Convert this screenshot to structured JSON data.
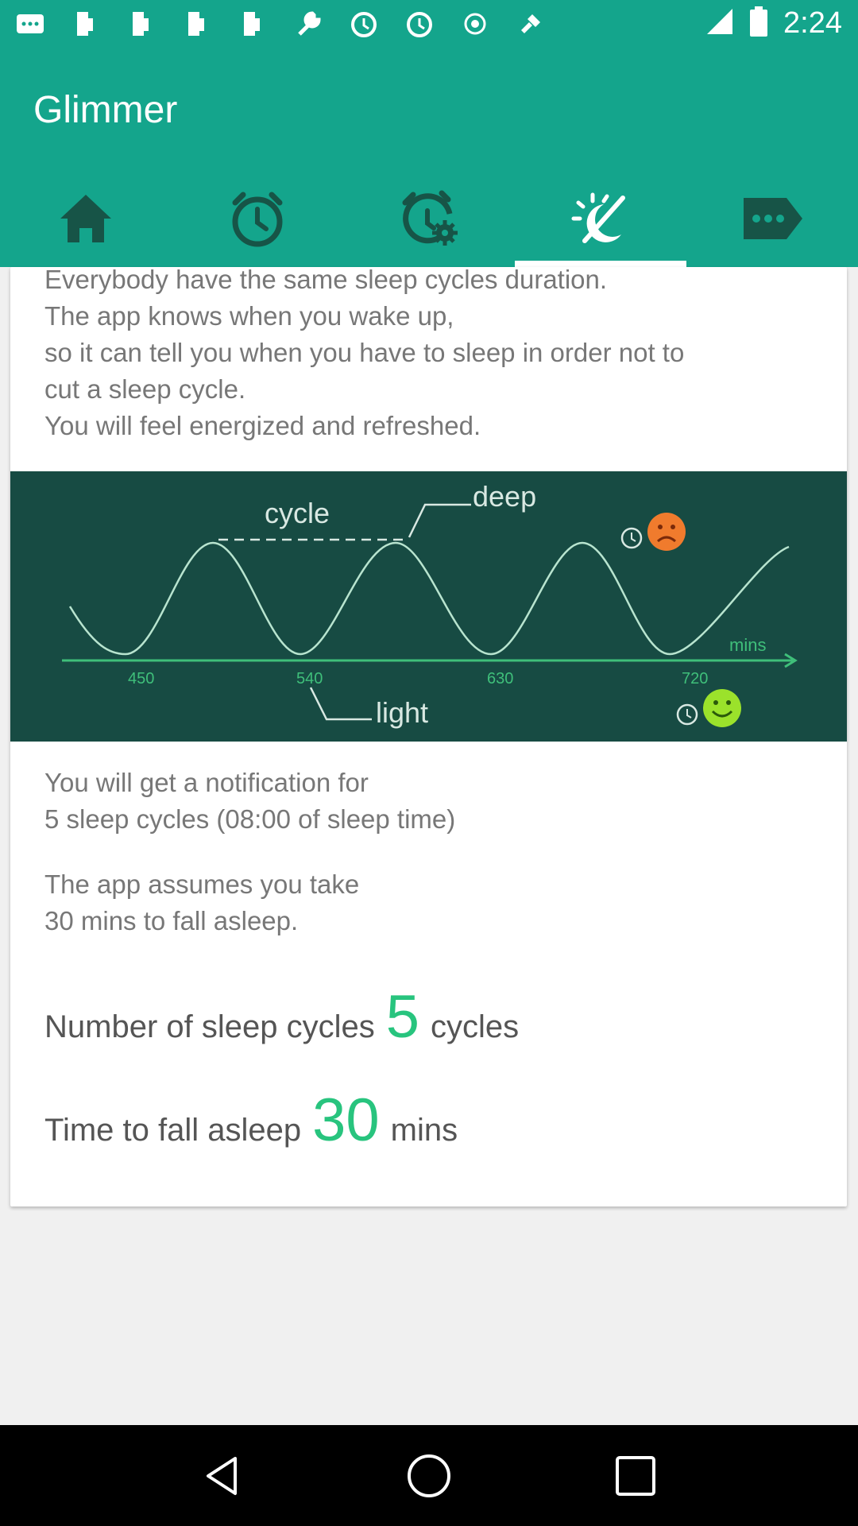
{
  "status_bar": {
    "time": "2:24"
  },
  "app": {
    "title": "Glimmer"
  },
  "tabs": [
    {
      "icon": "home-icon"
    },
    {
      "icon": "alarm-clock-icon"
    },
    {
      "icon": "alarm-settings-icon"
    },
    {
      "icon": "sleep-moon-icon",
      "active": true
    },
    {
      "icon": "more-icon"
    }
  ],
  "content": {
    "intro": "Everybody have the same sleep cycles duration.\nThe app knows when you wake up,\nso it can tell you when you have to sleep in order not to\ncut a sleep cycle.\nYou will feel energized and refreshed.",
    "graph": {
      "cycle_label": "cycle",
      "deep_label": "deep",
      "light_label": "light",
      "mins_label": "mins",
      "ticks": [
        "450",
        "540",
        "630",
        "720"
      ]
    },
    "notification": "You will get a notification for\n5 sleep cycles (08:00 of sleep time)",
    "assumption": "The app assumes you take\n30 mins to fall asleep.",
    "cycles_setting": {
      "label": "Number of sleep cycles",
      "value": "5",
      "unit": "cycles"
    },
    "fall_setting": {
      "label": "Time to fall asleep",
      "value": "30",
      "unit": "mins"
    }
  },
  "colors": {
    "accent": "#14a58c",
    "value_green": "#28c47e",
    "graph_bg": "#174b43"
  }
}
